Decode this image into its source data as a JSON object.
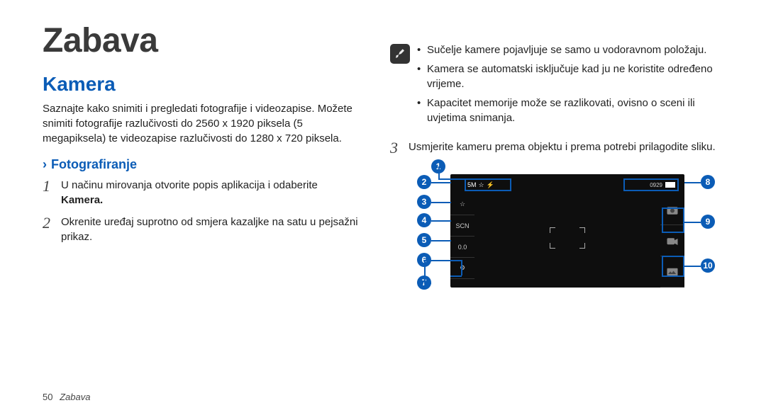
{
  "title": "Zabava",
  "section": "Kamera",
  "intro": "Saznajte kako snimiti i pregledati fotografije i videozapise. Možete snimiti fotografije razlučivosti do 2560 x 1920 piksela (5 megapiksela) te videozapise razlučivosti do 1280 x 720 piksela.",
  "subheading": "Fotografiranje",
  "steps": [
    {
      "num": "1",
      "text": "U načinu mirovanja otvorite popis aplikacija i odaberite ",
      "bold": "Kamera."
    },
    {
      "num": "2",
      "text": "Okrenite uređaj suprotno od smjera kazaljke na satu u pejsažni prikaz."
    },
    {
      "num": "3",
      "text": "Usmjerite kameru prema objektu i prema potrebi prilagodite sliku."
    }
  ],
  "notes": [
    "Sučelje kamere pojavljuje se samo u vodoravnom položaju.",
    "Kamera se automatski isključuje kad ju ne koristite određeno vrijeme.",
    "Kapacitet memorije može se razlikovati, ovisno o sceni ili uvjetima snimanja."
  ],
  "viewfinder": {
    "topbar": [
      "5M",
      "☆",
      "⚡"
    ],
    "topright_counter": "0929",
    "leftcol": [
      "☆",
      "SCN",
      "0.0",
      "⚙"
    ]
  },
  "callouts": [
    "1",
    "2",
    "3",
    "4",
    "5",
    "6",
    "7",
    "8",
    "9",
    "10"
  ],
  "footer_page": "50",
  "footer_title": "Zabava"
}
